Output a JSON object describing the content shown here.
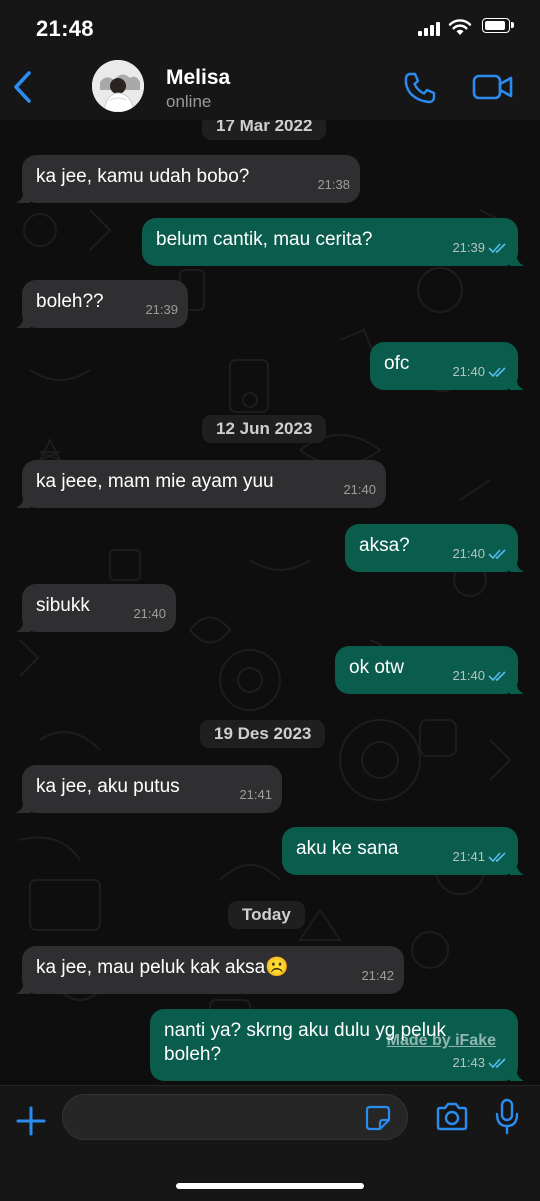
{
  "status_bar": {
    "time": "21:48",
    "battery_level": 0.9
  },
  "header": {
    "contact_name": "Melisa",
    "contact_status": "online"
  },
  "colors": {
    "accent": "#2b8cf0",
    "incoming_bubble": "#2f2f31",
    "outgoing_bubble": "#0a5c4c",
    "read_tick": "#53bdeb"
  },
  "chat": {
    "dates": [
      "17 Mar 2022",
      "12 Jun 2023",
      "19 Des 2023",
      "Today"
    ],
    "messages": [
      {
        "dir": "in",
        "text": "ka jee, kamu udah bobo?",
        "time": "21:38"
      },
      {
        "dir": "out",
        "text": "belum cantik, mau cerita?",
        "time": "21:39"
      },
      {
        "dir": "in",
        "text": "boleh??",
        "time": "21:39"
      },
      {
        "dir": "out",
        "text": "ofc",
        "time": "21:40"
      },
      {
        "dir": "in",
        "text": "ka jeee, mam mie ayam yuu",
        "time": "21:40"
      },
      {
        "dir": "out",
        "text": "aksa?",
        "time": "21:40"
      },
      {
        "dir": "in",
        "text": "sibukk",
        "time": "21:40"
      },
      {
        "dir": "out",
        "text": "ok otw",
        "time": "21:40"
      },
      {
        "dir": "in",
        "text": "ka jee, aku putus",
        "time": "21:41"
      },
      {
        "dir": "out",
        "text": "aku ke sana",
        "time": "21:41"
      },
      {
        "dir": "in",
        "text": "ka jee, mau peluk kak aksa☹️",
        "time": "21:42"
      },
      {
        "dir": "out",
        "line1": "nanti ya? skrng aku dulu yg peluk",
        "line2": "boleh?",
        "time": "21:43"
      }
    ],
    "watermark": "Made by iFake"
  },
  "input": {
    "placeholder": ""
  }
}
